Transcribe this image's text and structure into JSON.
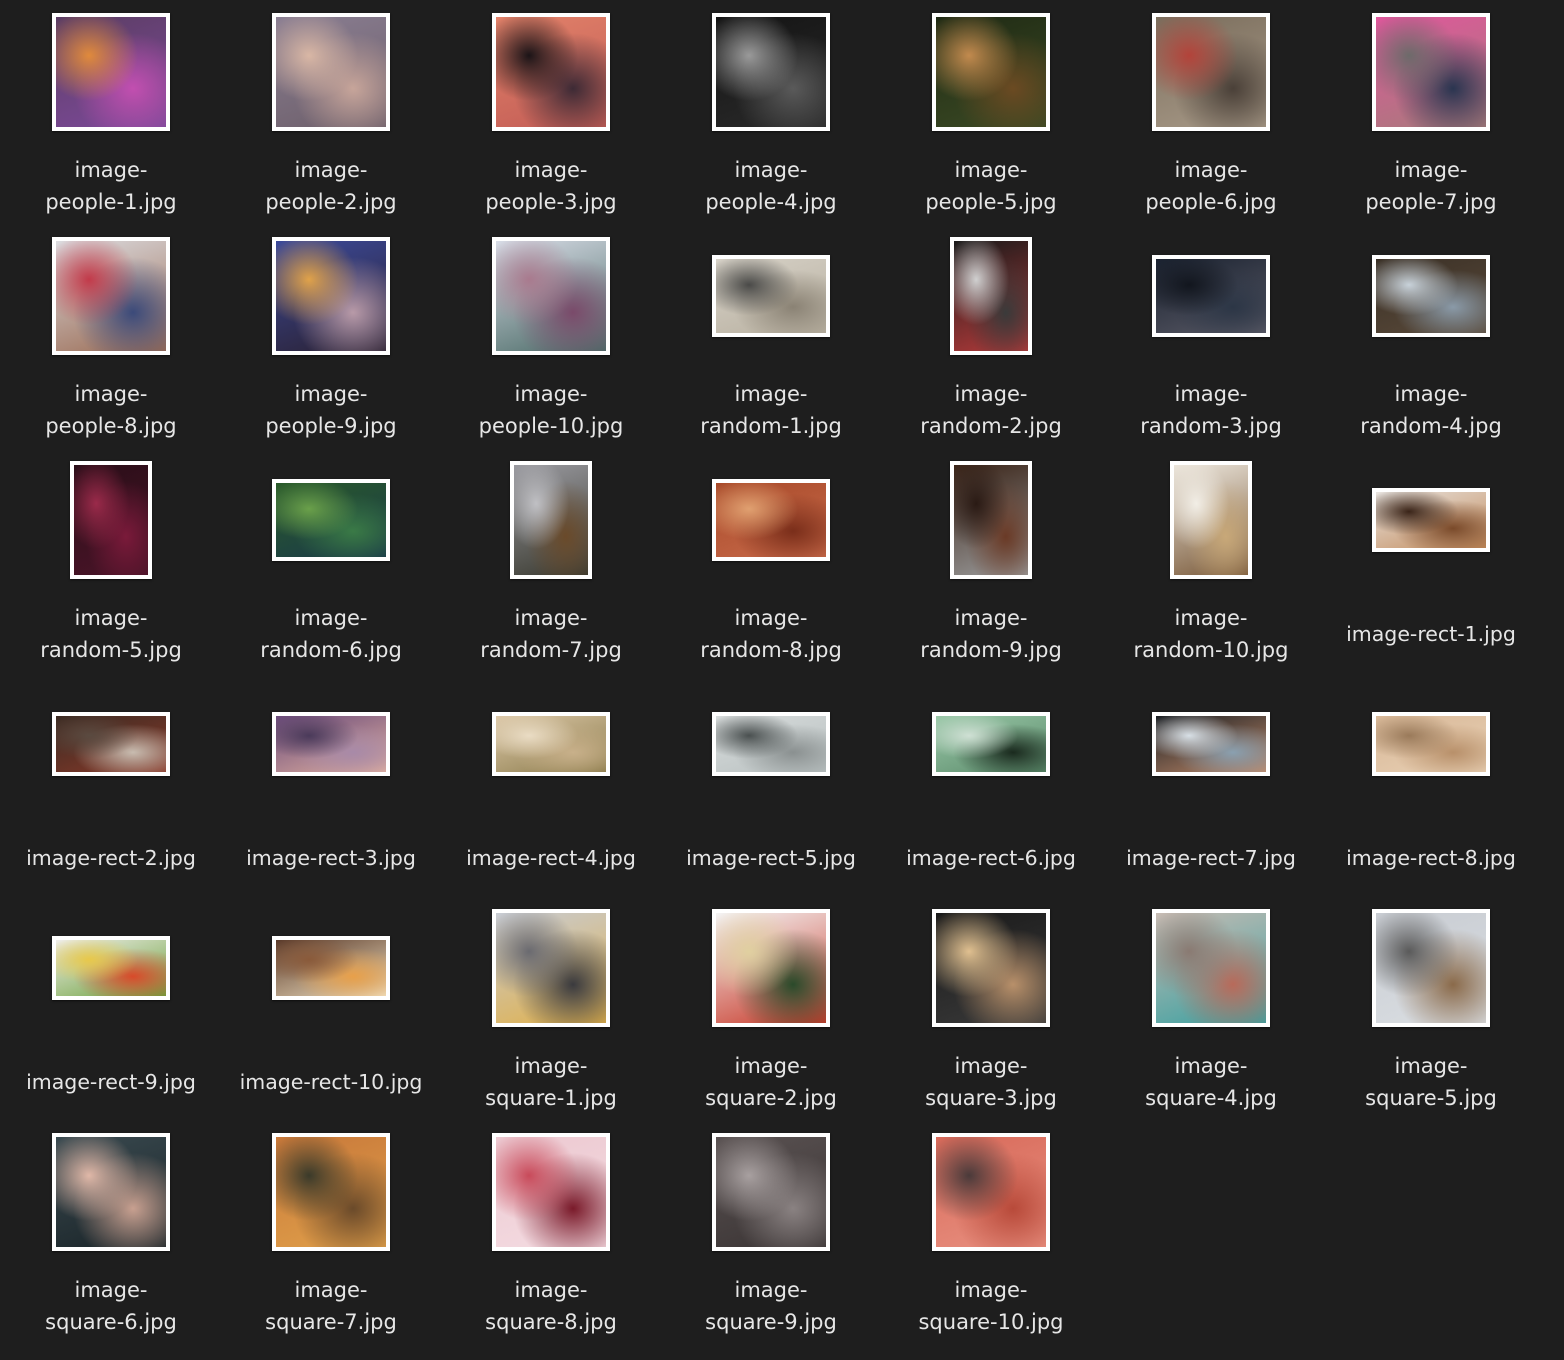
{
  "files": [
    {
      "label": "image-people-1.jpg",
      "line1": "image-",
      "line2": "people-1.jpg",
      "shape": "square",
      "colors": [
        "#5b3d63",
        "#c24fb0",
        "#7d4a9a",
        "#e08a3c"
      ]
    },
    {
      "label": "image-people-2.jpg",
      "line1": "image-",
      "line2": "people-2.jpg",
      "shape": "square",
      "colors": [
        "#8a7e92",
        "#c7a59a",
        "#6d5f6a",
        "#d9b7a5"
      ]
    },
    {
      "label": "image-people-3.jpg",
      "line1": "image-",
      "line2": "people-3.jpg",
      "shape": "square",
      "colors": [
        "#e2826a",
        "#3d2a35",
        "#c25c55",
        "#1b1417"
      ]
    },
    {
      "label": "image-people-4.jpg",
      "line1": "image-",
      "line2": "people-4.jpg",
      "shape": "square",
      "colors": [
        "#141414",
        "#5a5a5a",
        "#2a2a2a",
        "#9a9a9a"
      ]
    },
    {
      "label": "image-people-5.jpg",
      "line1": "image-",
      "line2": "people-5.jpg",
      "shape": "square",
      "colors": [
        "#1f2a14",
        "#6b4a22",
        "#3b4a24",
        "#c28a4e"
      ]
    },
    {
      "label": "image-people-6.jpg",
      "line1": "image-",
      "line2": "people-6.jpg",
      "shape": "square",
      "colors": [
        "#7a6d5c",
        "#4a4038",
        "#a89a88",
        "#b3433a"
      ]
    },
    {
      "label": "image-people-7.jpg",
      "line1": "image-",
      "line2": "people-7.jpg",
      "shape": "square",
      "colors": [
        "#e0579c",
        "#2a3550",
        "#a67b7a",
        "#6d6a6a"
      ]
    },
    {
      "label": "image-people-8.jpg",
      "line1": "image-",
      "line2": "people-8.jpg",
      "shape": "square",
      "colors": [
        "#dcdce0",
        "#3b4a7a",
        "#9a6a52",
        "#c23a4a"
      ]
    },
    {
      "label": "image-people-9.jpg",
      "line1": "image-",
      "line2": "people-9.jpg",
      "shape": "square",
      "colors": [
        "#3c4a9a",
        "#b89aa8",
        "#2a2030",
        "#e0a24a"
      ]
    },
    {
      "label": "image-people-10.jpg",
      "line1": "image-",
      "line2": "people-10.jpg",
      "shape": "square",
      "colors": [
        "#d8dce6",
        "#7a4a6a",
        "#4a6a66",
        "#a97a8e"
      ]
    },
    {
      "label": "image-random-1.jpg",
      "line1": "image-",
      "line2": "random-1.jpg",
      "shape": "rect",
      "colors": [
        "#d7d2c8",
        "#8a8274",
        "#b8b0a0",
        "#4a4a48"
      ]
    },
    {
      "label": "image-random-2.jpg",
      "line1": "image-",
      "line2": "random-2.jpg",
      "shape": "tall",
      "colors": [
        "#1a1a1a",
        "#3a3a3a",
        "#b33a3a",
        "#d0d0d0"
      ]
    },
    {
      "label": "image-random-3.jpg",
      "line1": "image-",
      "line2": "random-3.jpg",
      "shape": "rect",
      "colors": [
        "#1a2230",
        "#2c3646",
        "#5a5a66",
        "#12161e"
      ]
    },
    {
      "label": "image-random-4.jpg",
      "line1": "image-",
      "line2": "random-4.jpg",
      "shape": "rect",
      "colors": [
        "#3a3026",
        "#8a9aa8",
        "#5a4a3a",
        "#c8d2da"
      ]
    },
    {
      "label": "image-random-5.jpg",
      "line1": "image-",
      "line2": "random-5.jpg",
      "shape": "tall",
      "colors": [
        "#2a0e18",
        "#7a1a3a",
        "#4a1428",
        "#9a2a4a"
      ]
    },
    {
      "label": "image-random-6.jpg",
      "line1": "image-",
      "line2": "random-6.jpg",
      "shape": "rect",
      "colors": [
        "#2a5a2a",
        "#3a7a46",
        "#1a3a4a",
        "#6aa04a"
      ]
    },
    {
      "label": "image-random-7.jpg",
      "line1": "image-",
      "line2": "random-7.jpg",
      "shape": "tall",
      "colors": [
        "#9a9aa0",
        "#6a4a2a",
        "#3a3a30",
        "#c0c0c4"
      ]
    },
    {
      "label": "image-random-8.jpg",
      "line1": "image-",
      "line2": "random-8.jpg",
      "shape": "rect",
      "colors": [
        "#a84a2a",
        "#7a2e1a",
        "#c86a4a",
        "#e0a070"
      ]
    },
    {
      "label": "image-random-9.jpg",
      "line1": "image-",
      "line2": "random-9.jpg",
      "shape": "tall",
      "colors": [
        "#3a2418",
        "#6a3a26",
        "#9a9a9a",
        "#2a1a14"
      ]
    },
    {
      "label": "image-random-10.jpg",
      "line1": "image-",
      "line2": "random-10.jpg",
      "shape": "tall",
      "colors": [
        "#ece6dc",
        "#c8a878",
        "#7a5a3a",
        "#f2eee6"
      ]
    },
    {
      "label": "image-rect-1.jpg",
      "line1": "image-rect-1.jpg",
      "line2": "",
      "shape": "wide",
      "colors": [
        "#e8e4e0",
        "#7a4a2a",
        "#c28a5a",
        "#3a2418"
      ]
    },
    {
      "label": "image-rect-2.jpg",
      "line1": "image-rect-2.jpg",
      "line2": "",
      "shape": "wide",
      "colors": [
        "#3a2a22",
        "#c8bcb0",
        "#8a3a2a",
        "#5a4a40"
      ]
    },
    {
      "label": "image-rect-3.jpg",
      "line1": "image-rect-3.jpg",
      "line2": "",
      "shape": "wide",
      "colors": [
        "#6a4a7a",
        "#a88aa8",
        "#e0b0a0",
        "#4a3a5a"
      ]
    },
    {
      "label": "image-rect-4.jpg",
      "line1": "image-rect-4.jpg",
      "line2": "",
      "shape": "wide",
      "colors": [
        "#dcc8a8",
        "#c8b08a",
        "#8a7a4a",
        "#eadcc4"
      ]
    },
    {
      "label": "image-rect-5.jpg",
      "line1": "image-rect-5.jpg",
      "line2": "",
      "shape": "wide",
      "colors": [
        "#d8dcdc",
        "#8a9090",
        "#b8c0c0",
        "#4a5050"
      ]
    },
    {
      "label": "image-rect-6.jpg",
      "line1": "image-rect-6.jpg",
      "line2": "",
      "shape": "wide",
      "colors": [
        "#9ac8a8",
        "#1a2a1e",
        "#5a8a6a",
        "#cfe0d4"
      ]
    },
    {
      "label": "image-rect-7.jpg",
      "line1": "image-rect-7.jpg",
      "line2": "",
      "shape": "wide",
      "colors": [
        "#1a1e22",
        "#8aa0b0",
        "#c08a6a",
        "#d8e0e6"
      ]
    },
    {
      "label": "image-rect-8.jpg",
      "line1": "image-rect-8.jpg",
      "line2": "",
      "shape": "wide",
      "colors": [
        "#d8b898",
        "#b8906a",
        "#e8d0b4",
        "#9a7a5a"
      ]
    },
    {
      "label": "image-rect-9.jpg",
      "line1": "image-rect-9.jpg",
      "line2": "",
      "shape": "wide",
      "colors": [
        "#f0eeea",
        "#d84a2a",
        "#6aa03a",
        "#e8c84a"
      ]
    },
    {
      "label": "image-rect-10.jpg",
      "line1": "image-rect-10.jpg",
      "line2": "",
      "shape": "wide",
      "colors": [
        "#5a3a2a",
        "#e8a04a",
        "#f0e0c0",
        "#8a5a3a"
      ]
    },
    {
      "label": "image-square-1.jpg",
      "line1": "image-",
      "line2": "square-1.jpg",
      "shape": "square",
      "colors": [
        "#c8ccd4",
        "#3a3a3e",
        "#e0b04a",
        "#6a6a70"
      ]
    },
    {
      "label": "image-square-2.jpg",
      "line1": "image-",
      "line2": "square-2.jpg",
      "shape": "square",
      "colors": [
        "#f4f4f4",
        "#2a4a2a",
        "#c83a2a",
        "#e0d0a0"
      ]
    },
    {
      "label": "image-square-3.jpg",
      "line1": "image-",
      "line2": "square-3.jpg",
      "shape": "square",
      "colors": [
        "#1a1a1a",
        "#b8906a",
        "#3a3a3a",
        "#e0c090"
      ]
    },
    {
      "label": "image-square-4.jpg",
      "line1": "image-",
      "line2": "square-4.jpg",
      "shape": "square",
      "colors": [
        "#c8bcb4",
        "#b86a5a",
        "#3aa0a0",
        "#8a7a72"
      ]
    },
    {
      "label": "image-square-5.jpg",
      "line1": "image-",
      "line2": "square-5.jpg",
      "shape": "square",
      "colors": [
        "#c8ccd2",
        "#8a6a4a",
        "#dadee2",
        "#5a5a5a"
      ]
    },
    {
      "label": "image-square-6.jpg",
      "line1": "image-",
      "line2": "square-6.jpg",
      "shape": "square",
      "colors": [
        "#3a4a50",
        "#c8a090",
        "#1a2428",
        "#e0b8a8"
      ]
    },
    {
      "label": "image-square-7.jpg",
      "line1": "image-",
      "line2": "square-7.jpg",
      "shape": "square",
      "colors": [
        "#c8783a",
        "#6a4a2a",
        "#e0a04a",
        "#3a3a2a"
      ]
    },
    {
      "label": "image-square-8.jpg",
      "line1": "image-",
      "line2": "square-8.jpg",
      "shape": "square",
      "colors": [
        "#ecc8d0",
        "#7a1a2a",
        "#f4dce2",
        "#c84a5a"
      ]
    },
    {
      "label": "image-square-9.jpg",
      "line1": "image-",
      "line2": "square-9.jpg",
      "shape": "square",
      "colors": [
        "#5a5252",
        "#8a8282",
        "#3a3434",
        "#a8a0a0"
      ]
    },
    {
      "label": "image-square-10.jpg",
      "line1": "image-",
      "line2": "square-10.jpg",
      "shape": "square",
      "colors": [
        "#d86a5a",
        "#b84a3a",
        "#e89080",
        "#4a3a3a"
      ]
    }
  ]
}
